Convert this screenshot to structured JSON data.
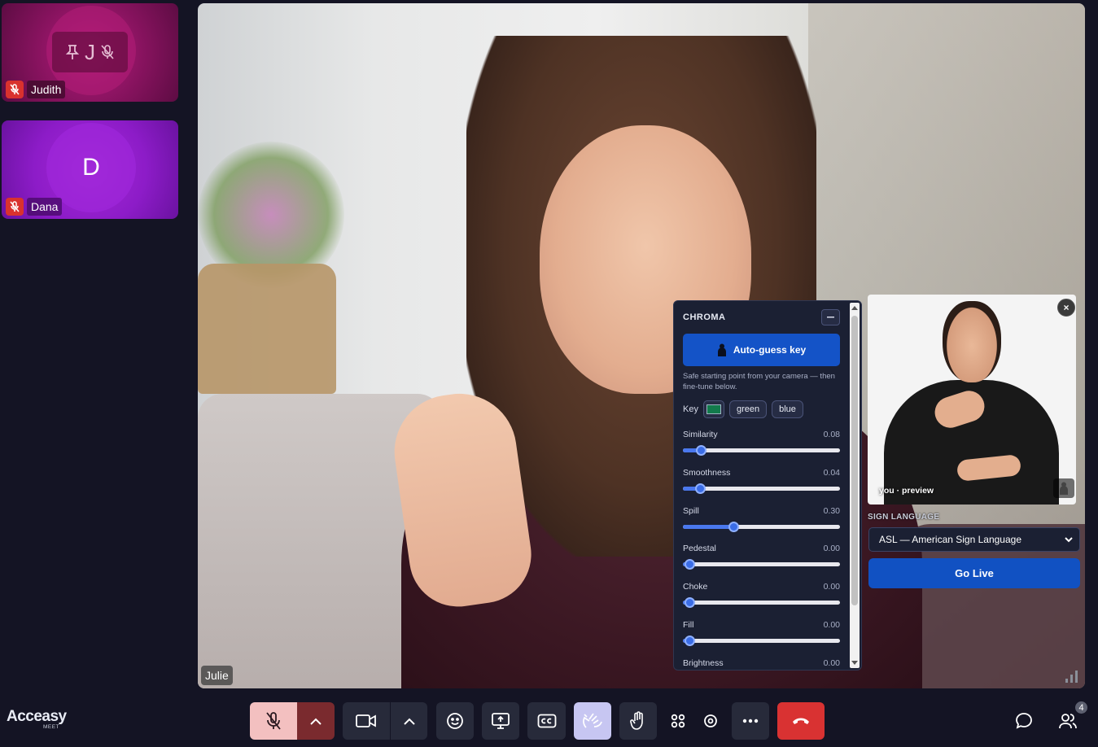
{
  "participants": [
    {
      "initial": "J",
      "name": "Judith",
      "color": "#a3186f",
      "muted": true
    },
    {
      "initial": "D",
      "name": "Dana",
      "color": "#951fcd",
      "muted": true
    }
  ],
  "main_video": {
    "name": "Julie"
  },
  "chroma": {
    "title": "CHROMA",
    "auto_button": "Auto-guess key",
    "help_text": "Safe starting point from your camera — then fine-tune below.",
    "key_label": "Key",
    "key_color": "#127a4c",
    "key_options": [
      "green",
      "blue"
    ],
    "sliders": [
      {
        "label": "Similarity",
        "value": "0.08",
        "fraction": 0.08
      },
      {
        "label": "Smoothness",
        "value": "0.04",
        "fraction": 0.07
      },
      {
        "label": "Spill",
        "value": "0.30",
        "fraction": 0.3
      },
      {
        "label": "Pedestal",
        "value": "0.00",
        "fraction": 0.0
      },
      {
        "label": "Choke",
        "value": "0.00",
        "fraction": 0.0
      },
      {
        "label": "Fill",
        "value": "0.00",
        "fraction": 0.0
      },
      {
        "label": "Brightness",
        "value": "0.00",
        "fraction": 0.0
      }
    ]
  },
  "sign_language": {
    "preview_label": "you · preview",
    "section_label": "SIGN LANGUAGE",
    "selected": "ASL — American Sign Language",
    "go_live": "Go Live"
  },
  "brand": {
    "name": "Acceasy",
    "sub": "MEET"
  },
  "toolbar": {
    "people_count": "4",
    "accent_leave": "#d93232",
    "accent_mute": "#f3c0c0"
  }
}
